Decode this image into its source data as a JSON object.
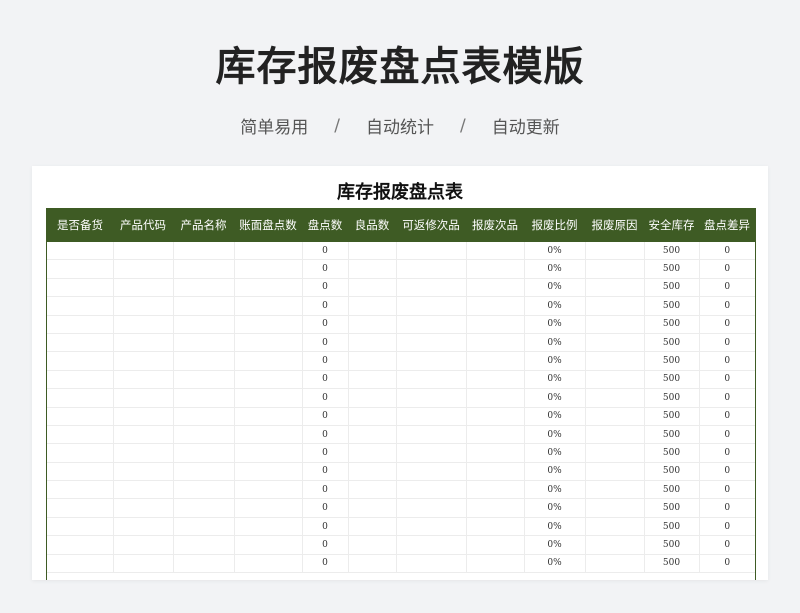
{
  "header": {
    "title": "库存报废盘点表模版",
    "features": [
      "简单易用",
      "自动统计",
      "自动更新"
    ],
    "separator": "/"
  },
  "sheet": {
    "title": "库存报废盘点表",
    "columns": [
      "是否备货",
      "产品代码",
      "产品名称",
      "账面盘点数",
      "盘点数",
      "良品数",
      "可返修次品",
      "报废次品",
      "报废比例",
      "报废原因",
      "安全库存",
      "盘点差异"
    ],
    "row_template": [
      "",
      "",
      "",
      "",
      "0",
      "",
      "",
      "",
      "0%",
      "",
      "500",
      "0"
    ],
    "row_count": 18
  },
  "colors": {
    "header_bg": "#3e5b24",
    "header_text": "#ffffff",
    "page_bg": "#f2f3f5"
  }
}
